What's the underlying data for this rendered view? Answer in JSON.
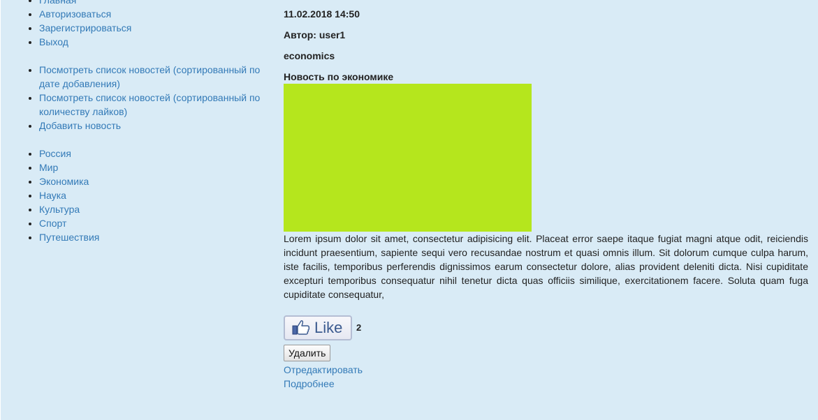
{
  "nav": {
    "main": [
      "Главная",
      "Авторизоваться",
      "Зарегистрироваться",
      "Выход"
    ],
    "news": [
      "Посмотреть список новостей (сортированный по дате добавления)",
      "Посмотреть список новостей (сортированный по количеству лайков)",
      "Добавить новость"
    ],
    "categories": [
      "Россия",
      "Мир",
      "Экономика",
      "Наука",
      "Культура",
      "Спорт",
      "Путешествия"
    ]
  },
  "article": {
    "datetime": "11.02.2018 14:50",
    "author": "Автор: user1",
    "category": "economics",
    "title": "Новость по экономике",
    "image_color": "#b5e61d",
    "body": "Lorem ipsum dolor sit amet, consectetur adipisicing elit. Placeat error saepe itaque fugiat magni atque odit, reiciendis incidunt praesentium, sapiente sequi vero recusandae nostrum et quasi omnis illum. Sit dolorum cumque culpa harum, iste facilis, temporibus perferendis dignissimos earum consectetur dolore, alias provident deleniti dicta. Nisi cupiditate excepturi temporibus consequatur nihil tenetur dicta quas officiis similique, exercitationem facere. Soluta quam fuga cupiditate consequatur,",
    "like_label": "Like",
    "like_count": "2",
    "delete_label": "Удалить",
    "edit_label": "Отредактировать",
    "more_label": "Подробнее"
  },
  "colors": {
    "background": "#d9ebf6",
    "link": "#337ab7"
  },
  "icons": {
    "like": "thumbs-up-icon"
  }
}
